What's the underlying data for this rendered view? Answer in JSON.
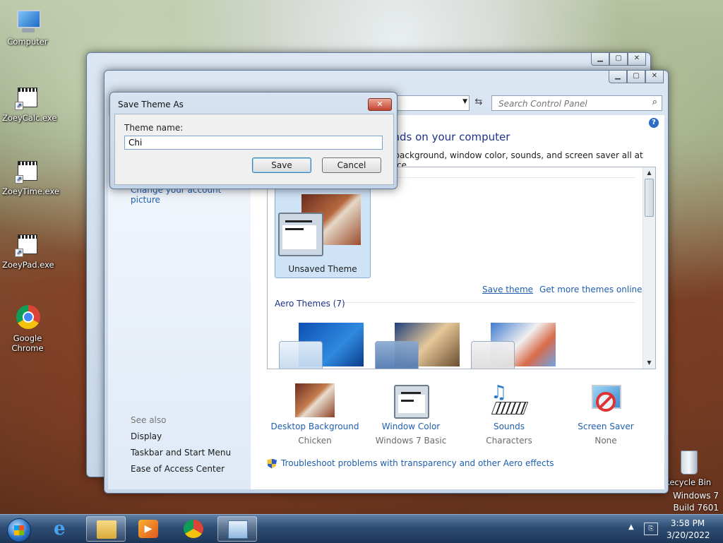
{
  "desktop": {
    "icons": [
      {
        "label": "Computer"
      },
      {
        "label": "ZoeyCalc.exe"
      },
      {
        "label": "ZoeyTime.exe"
      },
      {
        "label": "ZoeyPad.exe"
      },
      {
        "label": "Google Chrome"
      },
      {
        "label": "Recycle Bin"
      }
    ],
    "watermark": {
      "line1": "Windows 7",
      "line2": "Build 7601"
    }
  },
  "window": {
    "search_placeholder": "Search Control Panel",
    "heading": "Change the visuals and sounds on your computer",
    "heading_visible": "unds on your computer",
    "subtext_visible": "p background, window color, sounds, and screen saver all at once.",
    "sidebar": {
      "partial_item": "Change your account picture",
      "see_also": "See also",
      "links": [
        "Display",
        "Taskbar and Start Menu",
        "Ease of Access Center"
      ]
    },
    "themes": {
      "current_theme": "Unsaved Theme",
      "save_theme": "Save theme",
      "get_more": "Get more themes online",
      "aero_title": "Aero Themes (7)"
    },
    "bottom": [
      {
        "label": "Desktop Background",
        "value": "Chicken"
      },
      {
        "label": "Window Color",
        "value": "Windows 7 Basic"
      },
      {
        "label": "Sounds",
        "value": "Characters"
      },
      {
        "label": "Screen Saver",
        "value": "None"
      }
    ],
    "troubleshoot": "Troubleshoot problems with transparency and other Aero effects"
  },
  "dialog": {
    "title": "Save Theme As",
    "label": "Theme name:",
    "value": "Chi",
    "save": "Save",
    "cancel": "Cancel"
  },
  "taskbar": {
    "time": "3:58 PM",
    "date": "3/20/2022"
  }
}
